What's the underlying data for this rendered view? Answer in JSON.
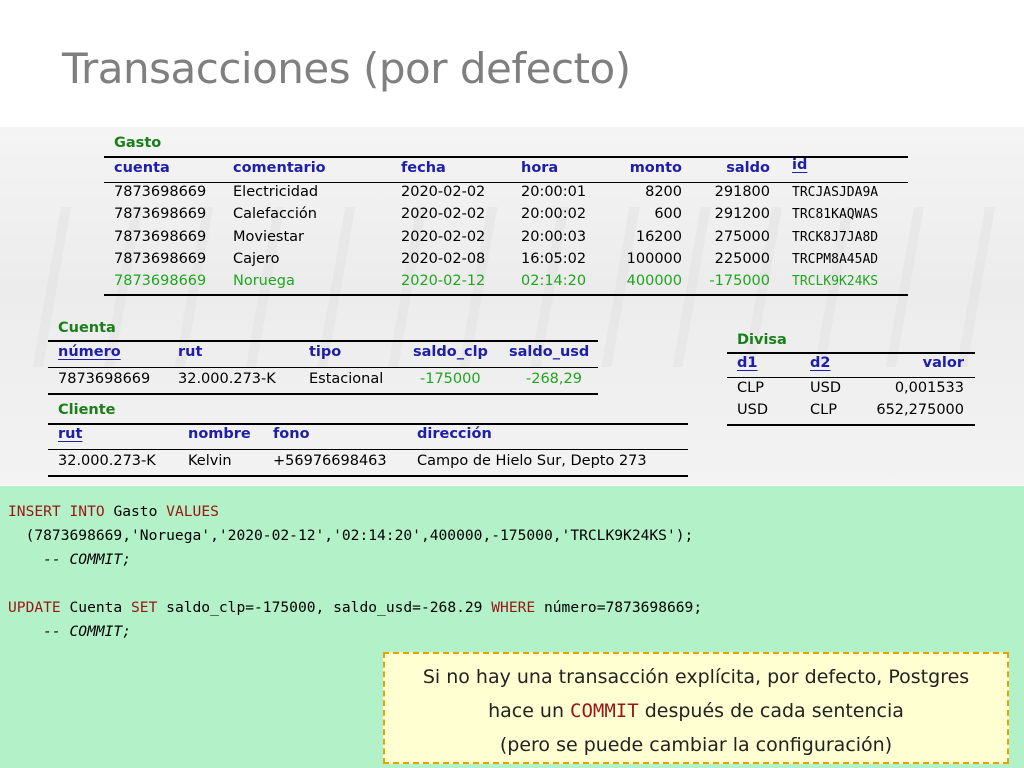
{
  "slide": {
    "title": "Transacciones (por defecto)"
  },
  "gasto": {
    "caption": "Gasto",
    "headers": [
      "cuenta",
      "comentario",
      "fecha",
      "hora",
      "monto",
      "saldo",
      "id"
    ],
    "rows": [
      [
        "7873698669",
        "Electricidad",
        "2020-02-02",
        "20:00:01",
        "8200",
        "291800",
        "TRCJASJDA9A"
      ],
      [
        "7873698669",
        "Calefacción",
        "2020-02-02",
        "20:00:02",
        "600",
        "291200",
        "TRC81KAQWAS"
      ],
      [
        "7873698669",
        "Moviestar",
        "2020-02-02",
        "20:00:03",
        "16200",
        "275000",
        "TRCK8J7JA8D"
      ],
      [
        "7873698669",
        "Cajero",
        "2020-02-08",
        "16:05:02",
        "100000",
        "225000",
        "TRCPM8A45AD"
      ],
      [
        "7873698669",
        "Noruega",
        "2020-02-12",
        "02:14:20",
        "400000",
        "-175000",
        "TRCLK9K24KS"
      ]
    ],
    "highlight_color": "#1fa51f"
  },
  "cuenta": {
    "caption": "Cuenta",
    "headers": [
      "número",
      "rut",
      "tipo",
      "saldo_clp",
      "saldo_usd"
    ],
    "rows": [
      [
        "7873698669",
        "32.000.273-K",
        "Estacional",
        "-175000",
        "-268,29"
      ]
    ]
  },
  "cliente": {
    "caption": "Cliente",
    "headers": [
      "rut",
      "nombre",
      "fono",
      "dirección"
    ],
    "rows": [
      [
        "32.000.273-K",
        "Kelvin",
        "+56976698463",
        "Campo de Hielo Sur, Depto 273"
      ]
    ]
  },
  "divisa": {
    "caption": "Divisa",
    "headers": [
      "d1",
      "d2",
      "valor"
    ],
    "rows": [
      [
        "CLP",
        "USD",
        "0,001533"
      ],
      [
        "USD",
        "CLP",
        "652,275000"
      ]
    ]
  },
  "sql": {
    "insert_kw": "INSERT INTO",
    "insert_table": " Gasto ",
    "values_kw": "VALUES",
    "insert_values": "  (7873698669,'Noruega','2020-02-12','02:14:20',400000,-175000,'TRCLK9K24KS');",
    "commit_comment": "    -- COMMIT;",
    "update_kw": "UPDATE",
    "update_table": " Cuenta ",
    "set_kw": "SET",
    "set_clause": " saldo_clp=-175000, saldo_usd=-268.29 ",
    "where_kw": "WHERE",
    "where_clause": " número=7873698669;",
    "commit_comment2": "    -- COMMIT;"
  },
  "note": {
    "line1": "Si no hay una transacción explícita, por defecto, Postgres",
    "line2_pre": "hace un ",
    "line2_kw": "COMMIT",
    "line2_post": " después de cada sentencia",
    "line3": "(pero se puede cambiar la configuración)"
  },
  "colors": {
    "caption": "#1a7f1a",
    "header": "#1e1ea8",
    "sql_bg": "#b3f1c8",
    "keyword": "#9a1515",
    "note_border": "#e6a200",
    "note_bg": "#ffffd2"
  }
}
